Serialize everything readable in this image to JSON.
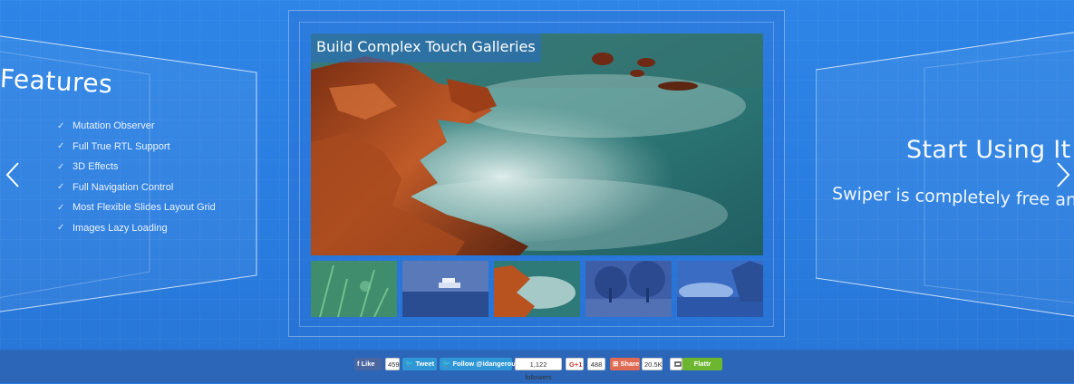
{
  "features_panel": {
    "title": "Features",
    "items": [
      "Mutation Observer",
      "Full True RTL Support",
      "3D Effects",
      "Full Navigation Control",
      "Most Flexible Slides Layout Grid",
      "Images Lazy Loading"
    ]
  },
  "gallery": {
    "caption": "Build Complex Touch Galleries"
  },
  "start_panel": {
    "title": "Start Using It N",
    "subtitle": "Swiper is completely free an"
  },
  "social": {
    "like_label": "Like",
    "like_count": "459",
    "tweet_label": "Tweet",
    "follow_label": "Follow @idangerous",
    "followers_count": "1,122 followers",
    "gplus_label": "G+1",
    "gplus_count": "488",
    "share_label": "Share",
    "share_count": "20.5K",
    "flattr_label": "Flattr"
  },
  "colors": {
    "background": "#2b7fe0",
    "bar": "#2b66b8",
    "facebook": "#4a66a0",
    "twitter": "#2f97d6",
    "share": "#e06b54",
    "flattr": "#6cb630"
  },
  "icons": {
    "prev": "chevron-left-icon",
    "next": "chevron-right-icon",
    "check": "check-icon"
  }
}
